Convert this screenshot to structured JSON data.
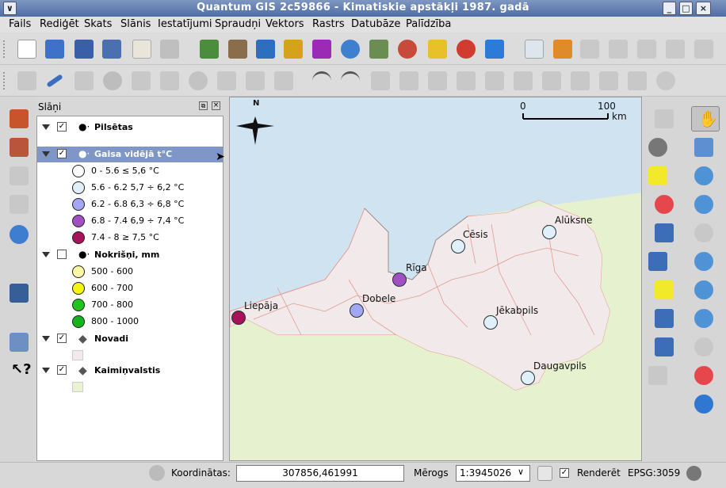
{
  "window": {
    "title": "Quantum GIS 2c59866 - Kimatiskie apstākļi 1987. gadā"
  },
  "menu": [
    "Fails",
    "Rediģēt",
    "Skats",
    "Slānis",
    "Iestatījumi",
    "Spraudņi",
    "Vektors",
    "Rastrs",
    "Datubāze",
    "Palīdzība"
  ],
  "panel": {
    "title": "Slāņi"
  },
  "layers": {
    "cities": {
      "name": "Pilsētas"
    },
    "temp": {
      "name": "Gaisa vidējā t°C",
      "classes": [
        {
          "label": "0 - 5.6 ≤ 5,6 °C",
          "color": "#ffffff"
        },
        {
          "label": "5.6 - 6.2 5,7 ÷ 6,2 °C",
          "color": "#dff0fb"
        },
        {
          "label": "6.2 - 6.8 6,3 ÷ 6,8 °C",
          "color": "#a3a6f2"
        },
        {
          "label": "6.8 - 7.4 6,9 ÷ 7,4 °C",
          "color": "#a34fc4"
        },
        {
          "label": "7.4 - 8 ≥ 7,5 °C",
          "color": "#a8125a"
        }
      ]
    },
    "precip": {
      "name": "Nokrišņi, mm",
      "classes": [
        {
          "label": "500 - 600",
          "color": "#fbf7a6"
        },
        {
          "label": "600 - 700",
          "color": "#f4f40f"
        },
        {
          "label": "700 - 800",
          "color": "#21c41e"
        },
        {
          "label": "800 - 1000",
          "color": "#14b51b"
        }
      ]
    },
    "novadi": {
      "name": "Novadi"
    },
    "neighbors": {
      "name": "Kaimiņvalstis"
    }
  },
  "map": {
    "scalebar": {
      "start": "0",
      "end": "100",
      "unit": "km"
    },
    "north": "N",
    "cities": [
      {
        "name": "Alūksne",
        "color": "#dff0fb"
      },
      {
        "name": "Cēsis",
        "color": "#dff0fb"
      },
      {
        "name": "Rīga",
        "color": "#a34fc4"
      },
      {
        "name": "Liepāja",
        "color": "#a8125a"
      },
      {
        "name": "Dobele",
        "color": "#a3a6f2"
      },
      {
        "name": "Jēkabpils",
        "color": "#dff0fb"
      },
      {
        "name": "Daugavpils",
        "color": "#dff0fb"
      }
    ]
  },
  "status": {
    "coord_label": "Koordinātas:",
    "coord_value": "307856,461991",
    "scale_label": "Mērogs",
    "scale_value": "1:3945026",
    "render_label": "Renderēt",
    "epsg": "EPSG:3059"
  }
}
